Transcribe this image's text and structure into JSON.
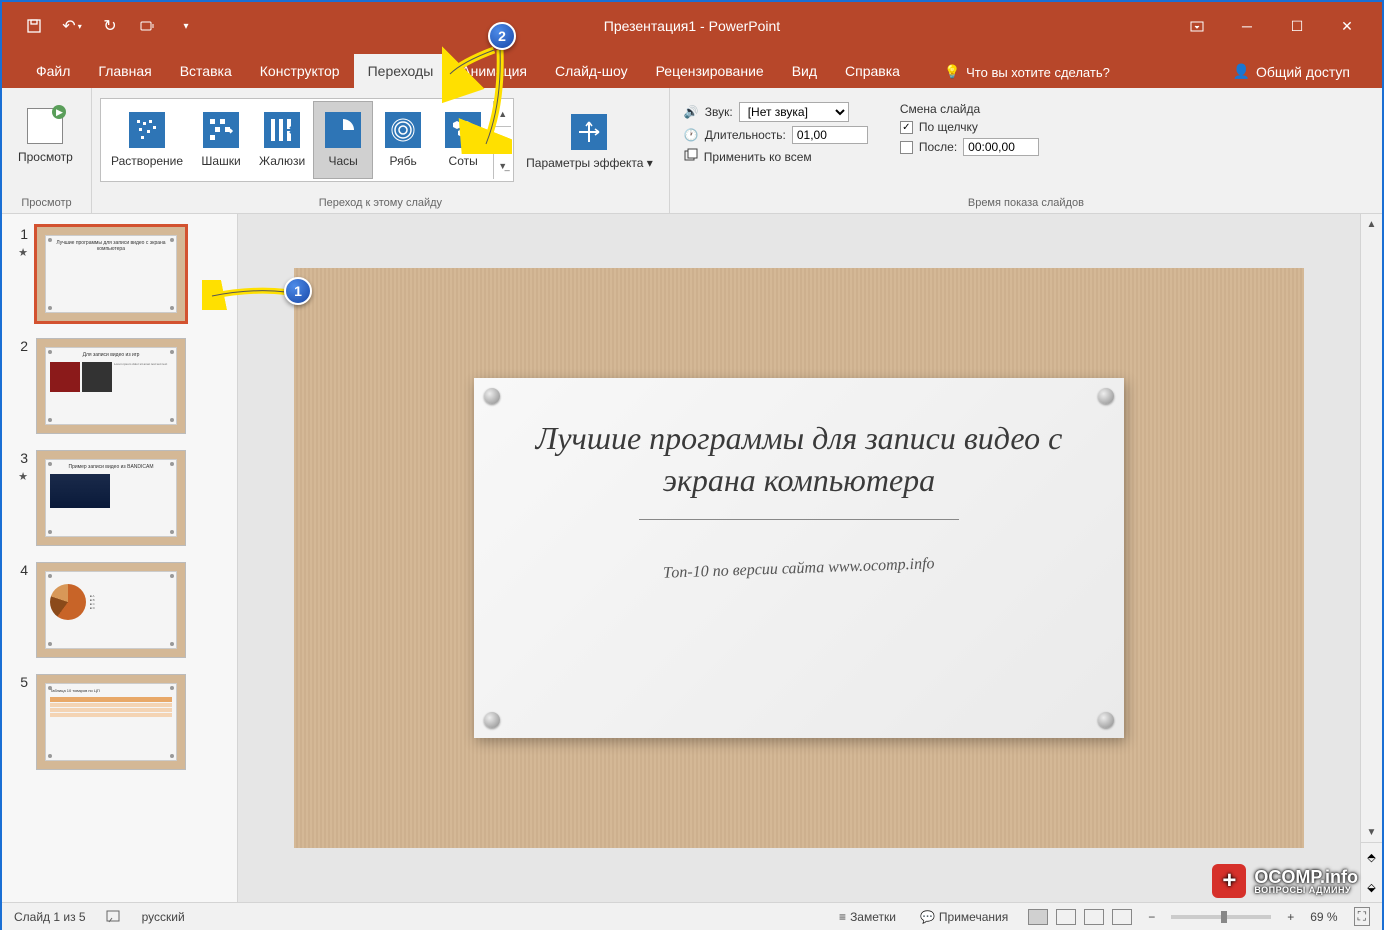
{
  "app": {
    "title": "Презентация1 - PowerPoint"
  },
  "tabs": {
    "items": [
      "Файл",
      "Главная",
      "Вставка",
      "Конструктор",
      "Переходы",
      "Анимация",
      "Слайд-шоу",
      "Рецензирование",
      "Вид",
      "Справка"
    ],
    "active_index": 4,
    "tell_me": "Что вы хотите сделать?",
    "share": "Общий доступ"
  },
  "ribbon": {
    "preview_group": {
      "label": "Просмотр",
      "button": "Просмотр"
    },
    "transition_group": {
      "label": "Переход к этому слайду",
      "items": [
        "Растворение",
        "Шашки",
        "Жалюзи",
        "Часы",
        "Рябь",
        "Соты"
      ],
      "selected_index": 3,
      "effect_options": "Параметры эффекта"
    },
    "timing_group": {
      "label": "Время показа слайдов",
      "sound_label": "Звук:",
      "sound_value": "[Нет звука]",
      "duration_label": "Длительность:",
      "duration_value": "01,00",
      "apply_all": "Применить ко всем",
      "advance_header": "Смена слайда",
      "on_click": "По щелчку",
      "after_label": "После:",
      "after_value": "00:00,00"
    }
  },
  "slides": {
    "count": 5,
    "selected": 1,
    "thumbs": [
      {
        "num": "1",
        "has_star": true,
        "title": "Лучшие программы для записи видео с экрана компьютера"
      },
      {
        "num": "2",
        "has_star": false,
        "title": "Для записи видео из игр"
      },
      {
        "num": "3",
        "has_star": true,
        "title": "Пример записи видео из BANDICAM"
      },
      {
        "num": "4",
        "has_star": false,
        "title": "Диаграмма"
      },
      {
        "num": "5",
        "has_star": false,
        "title": "Таблица 10 товаров по ЦП"
      }
    ]
  },
  "main_slide": {
    "title": "Лучшие программы для записи видео с экрана компьютера",
    "subtitle": "Топ-10 по версии сайта www.ocomp.info"
  },
  "statusbar": {
    "slide_info": "Слайд 1 из 5",
    "language": "русский",
    "notes": "Заметки",
    "comments": "Примечания",
    "zoom": "69 %"
  },
  "callouts": {
    "badge1": "1",
    "badge2": "2"
  },
  "watermark": {
    "top": "OCOMP.info",
    "bottom": "ВОПРОСЫ АДМИНУ"
  }
}
